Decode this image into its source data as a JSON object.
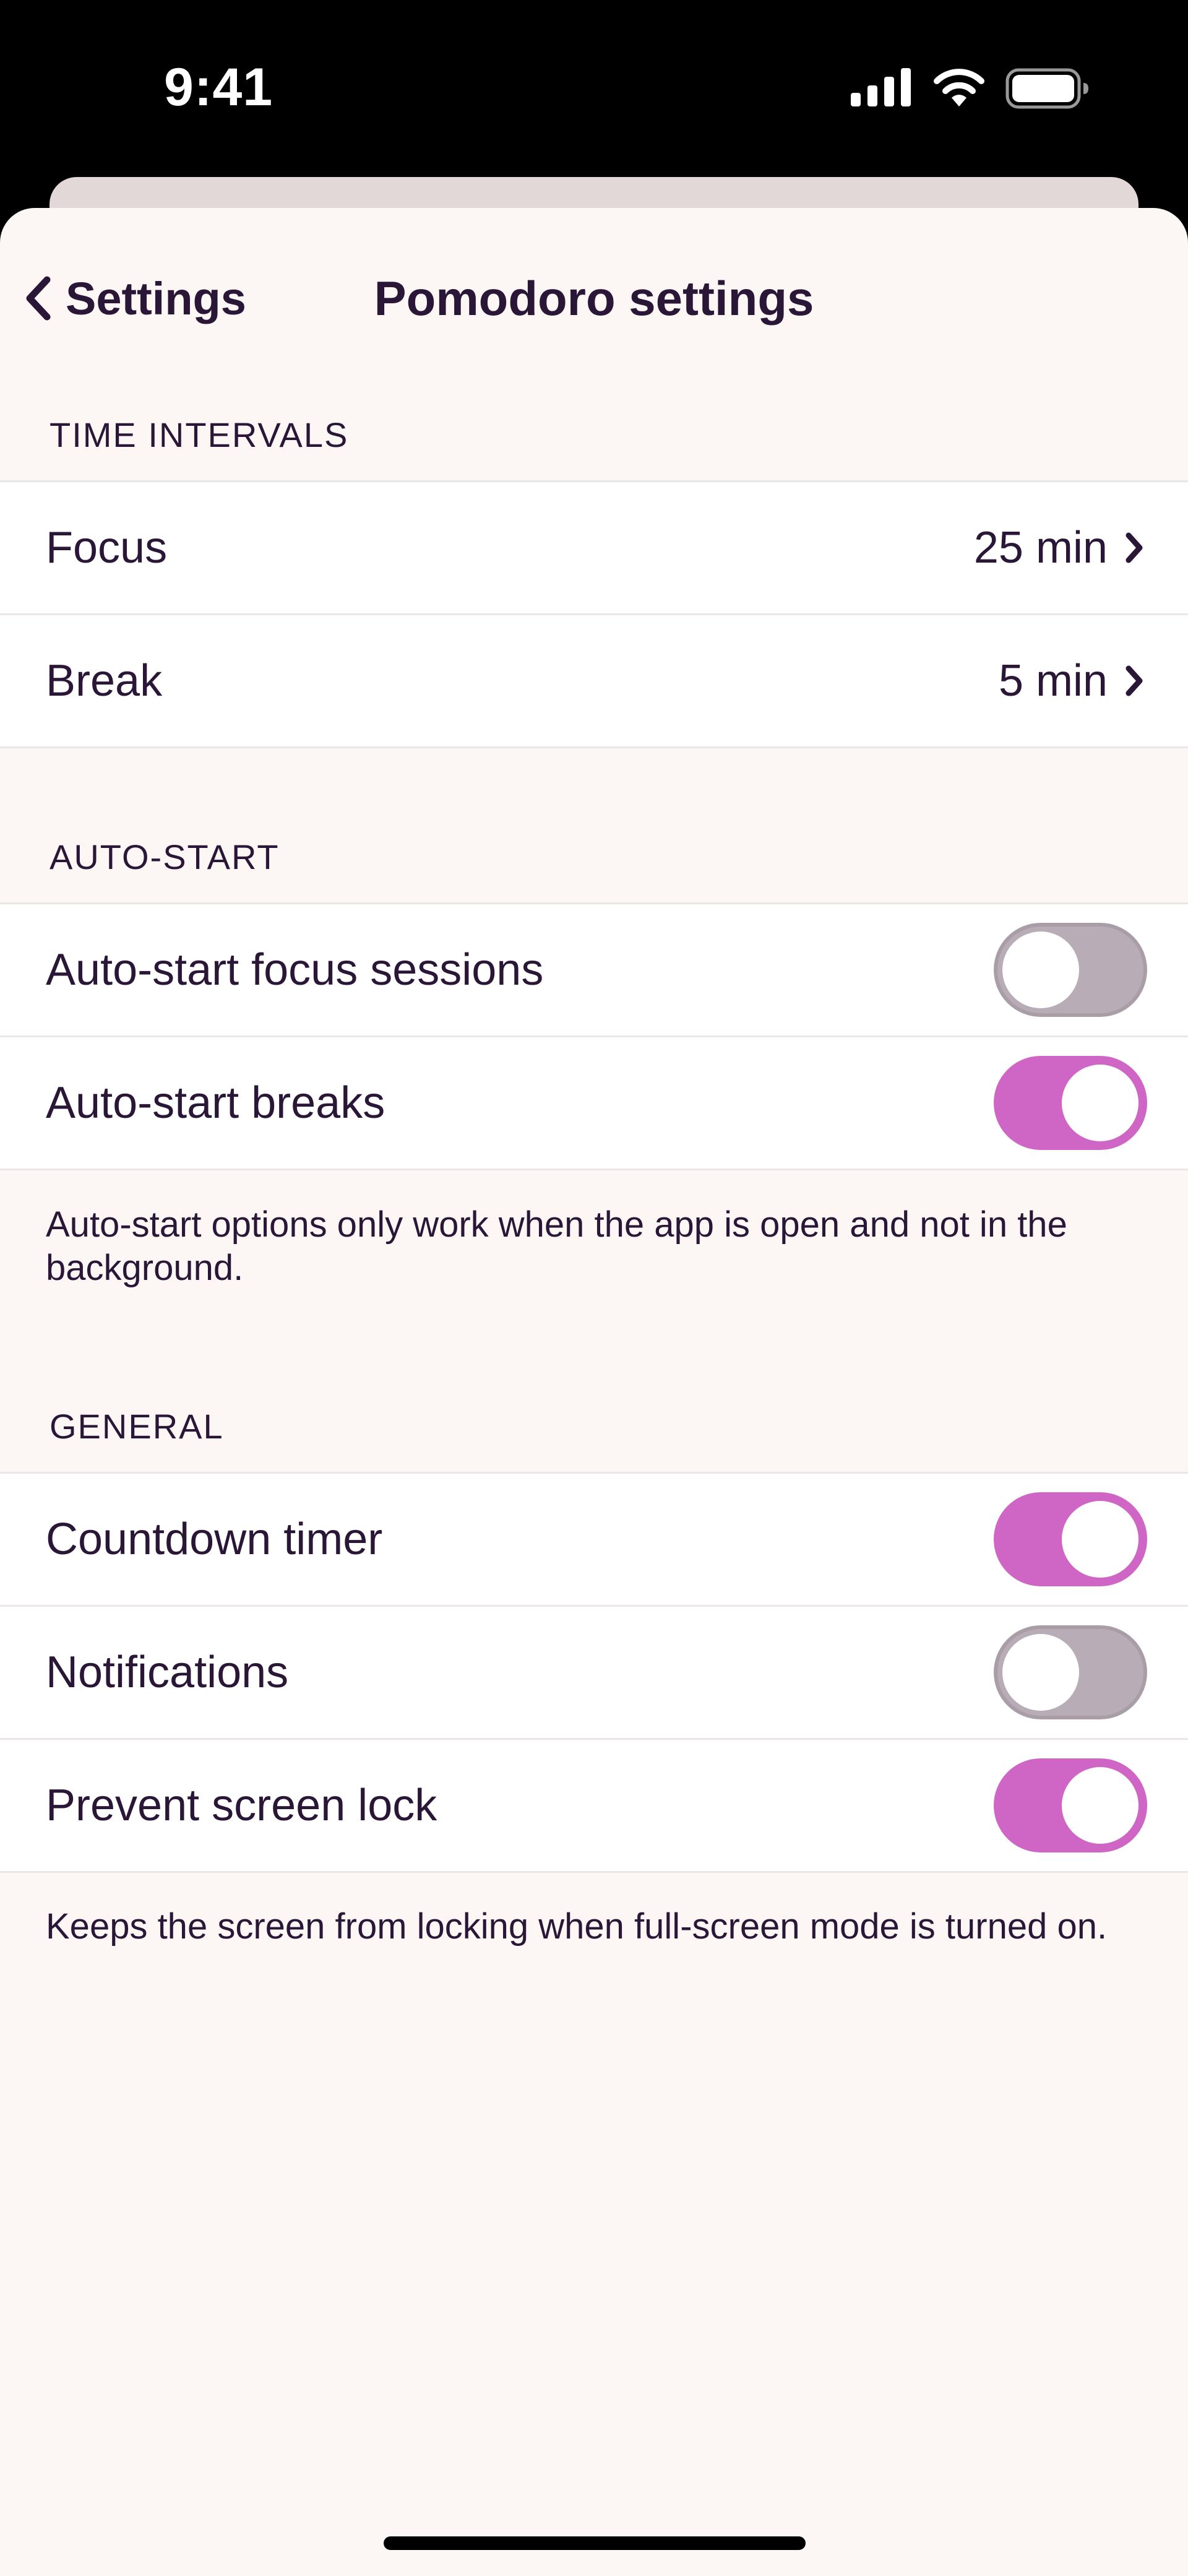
{
  "status_bar": {
    "time": "9:41",
    "icons": [
      "signal-icon",
      "wifi-icon",
      "battery-icon"
    ]
  },
  "nav": {
    "back_label": "Settings",
    "title": "Pomodoro settings"
  },
  "sections": {
    "time_intervals": {
      "header": "TIME INTERVALS",
      "rows": [
        {
          "label": "Focus",
          "value": "25 min"
        },
        {
          "label": "Break",
          "value": "5 min"
        }
      ]
    },
    "auto_start": {
      "header": "AUTO-START",
      "rows": [
        {
          "label": "Auto-start focus sessions",
          "on": false
        },
        {
          "label": "Auto-start breaks",
          "on": true
        }
      ],
      "footnote": "Auto-start options only work when the app is open and not in the background."
    },
    "general": {
      "header": "GENERAL",
      "rows": [
        {
          "label": "Countdown timer",
          "on": true
        },
        {
          "label": "Notifications",
          "on": false
        },
        {
          "label": "Prevent screen lock",
          "on": true
        }
      ],
      "footnote": "Keeps the screen from locking when full-screen mode is turned on."
    }
  },
  "colors": {
    "accent": "#cf65c5",
    "toggle_off": "#b8adb6",
    "background": "#fcf7f5",
    "text": "#2a1636"
  }
}
